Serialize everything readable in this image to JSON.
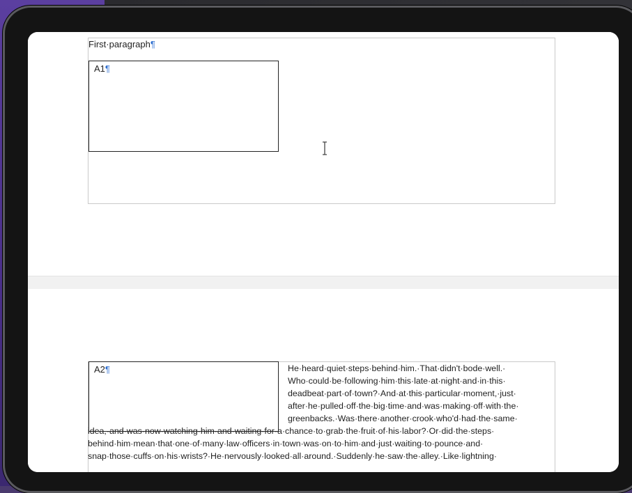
{
  "document": {
    "first_paragraph": "First·paragraph",
    "pilcrow": "¶",
    "box1_label": "A1",
    "box2_label": "A2",
    "text_lines": [
      "He·heard·quiet·steps·behind·him.·That·didn't·bode·well.·",
      "Who·could·be·following·him·this·late·at·night·and·in·this·",
      "deadbeat·part·of·town?·And·at·this·particular·moment,·just·",
      "after·he·pulled·off·the·big·time·and·was·making·off·with·the·",
      "greenbacks.·Was·there·another·crook·who'd·had·the·same·",
      "idea,·and·was·now·watching·him·and·waiting·for·a·chance·to·grab·the·fruit·of·his·labor?·Or·did·the·steps·",
      "behind·him·mean·that·one·of·many·law·officers·in·town·was·on·to·him·and·just·waiting·to·pounce·and·",
      "snap·those·cuffs·on·his·wrists?·He·nervously·looked·all·around.·Suddenly·he·saw·the·alley.·Like·lightning·"
    ]
  }
}
